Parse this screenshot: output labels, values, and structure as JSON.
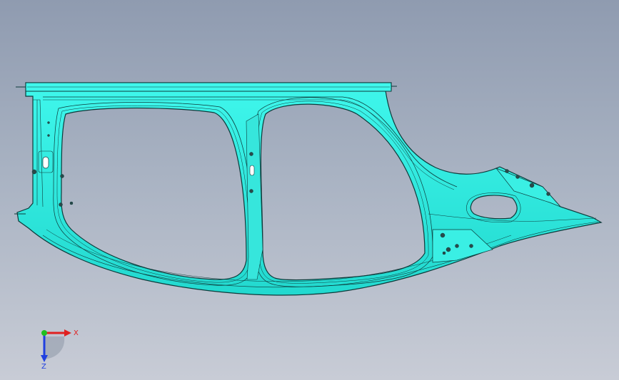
{
  "viewport": {
    "background_top": "#8f9bb0",
    "background_bottom": "#c8ccd6",
    "model_color": "#2ff0e4",
    "edge_color": "#0d3a3a"
  },
  "triad": {
    "x_label": "X",
    "z_label": "Z",
    "x_color": "#e02020",
    "y_color": "#20c020",
    "z_color": "#2040e0"
  }
}
